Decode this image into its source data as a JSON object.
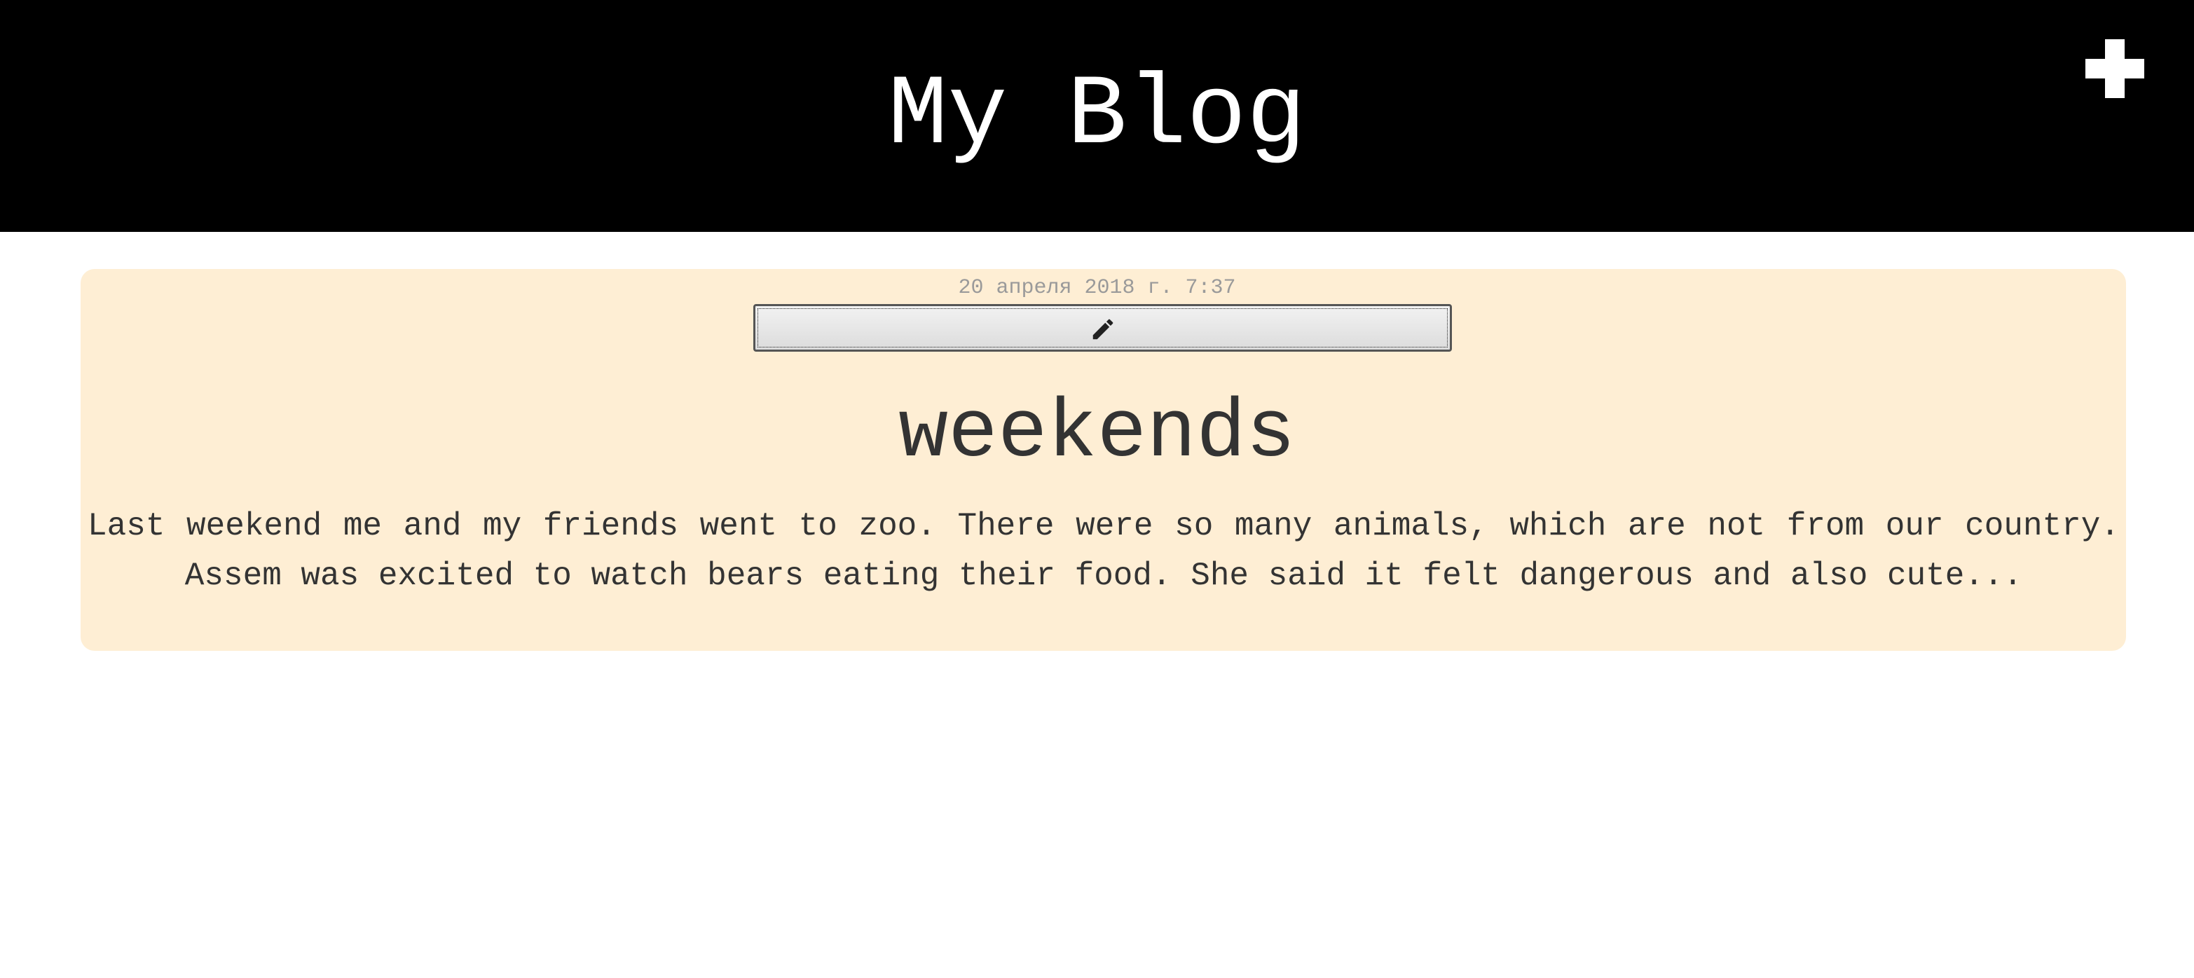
{
  "header": {
    "title": "My Blog",
    "add_icon": "plus-icon"
  },
  "post": {
    "date": "20 апреля 2018 г. 7:37",
    "edit_icon": "pencil-icon",
    "title": "weekends",
    "body": "Last weekend me and my friends went to zoo. There were so many animals, which are not from our country. Assem was excited to watch bears eating their food. She said it felt dangerous and also cute..."
  },
  "colors": {
    "header_bg": "#000000",
    "card_bg": "#feeed4",
    "text": "#333333",
    "date": "#9a9a9a"
  }
}
